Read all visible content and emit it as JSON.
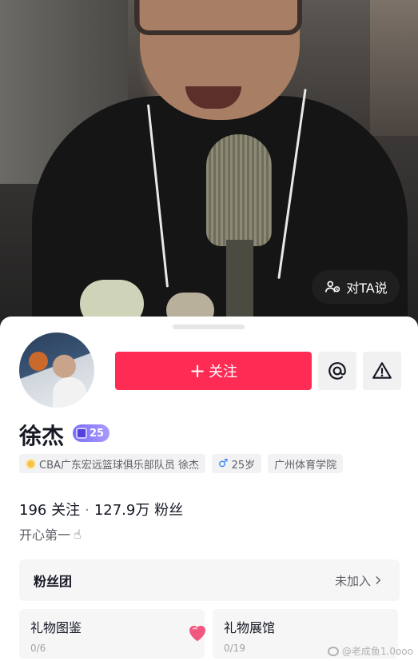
{
  "live": {
    "say_to_ta_label": "对TA说",
    "say_icon": "mic-people-icon"
  },
  "profile": {
    "follow_label": "关注",
    "follow_plus": "+",
    "at_icon": "at-icon",
    "report_icon": "warning-icon",
    "name": "徐杰",
    "level": "25",
    "tags": [
      {
        "icon": "verified-badge-icon",
        "text": "CBA广东宏远篮球俱乐部队员 徐杰"
      },
      {
        "icon": "male-icon",
        "symbol": "♂",
        "text": "25岁"
      },
      {
        "text": "广州体育学院"
      }
    ],
    "following_count": "196",
    "following_label": "关注",
    "separator": "·",
    "fans_count": "127.9万",
    "fans_label": "粉丝",
    "bio": "开心第一",
    "bio_emoji": "☝"
  },
  "fan_club": {
    "label": "粉丝团",
    "status": "未加入"
  },
  "cards": [
    {
      "title": "礼物图鉴",
      "sub": "0/6"
    },
    {
      "title": "礼物展馆",
      "sub": "0/19"
    }
  ],
  "watermark": "@老成鱼1.0ooo",
  "colors": {
    "primary": "#fe2c55",
    "level_badge": "#8b7cf8",
    "text": "#161823",
    "secondary_text": "#5e6068"
  }
}
